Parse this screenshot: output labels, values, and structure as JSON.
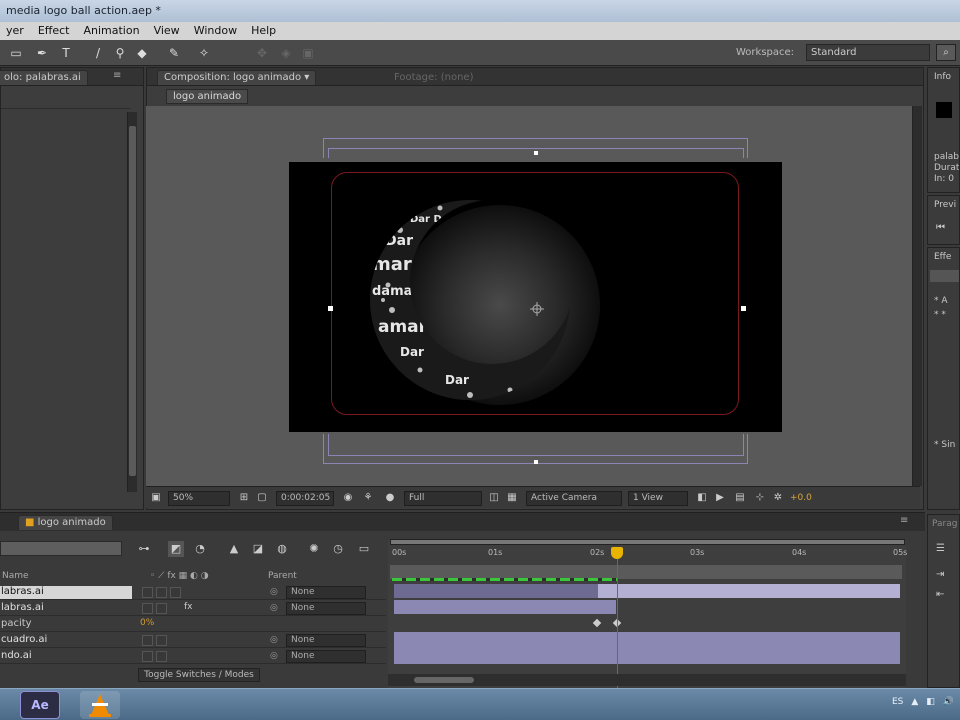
{
  "window": {
    "title": "media logo ball action.aep *"
  },
  "menu": {
    "items": [
      "yer",
      "Effect",
      "Animation",
      "View",
      "Window",
      "Help"
    ]
  },
  "toolbar": {
    "workspace_label": "Workspace:",
    "workspace_value": "Standard",
    "search_icon": "search-icon"
  },
  "left_panel": {
    "tab_label": "olo: palabras.ai"
  },
  "composition": {
    "tab_label": "Composition: logo animado",
    "footage_tab": "Footage: (none)",
    "layer_chip": "logo animado",
    "art_words": [
      "Dar Dent",
      "Dar",
      "mar",
      "dama",
      "amar",
      "Dar",
      "Dar"
    ],
    "controls": {
      "zoom": "50%",
      "timecode": "0:00:02:05",
      "resolution": "Full",
      "camera": "Active Camera",
      "views": "1 View",
      "exposure": "+0.0"
    }
  },
  "timeline": {
    "tab_label": "logo animado",
    "columns": {
      "name": "Name",
      "parent": "Parent"
    },
    "ruler": [
      "00s",
      "01s",
      "02s",
      "03s",
      "04s",
      "05s"
    ],
    "layers": [
      {
        "name": "labras.ai",
        "parent": "None",
        "selected": true
      },
      {
        "name": "labras.ai",
        "parent": "None",
        "selected": false
      },
      {
        "name": "pacity",
        "value": "0%",
        "is_property": true
      },
      {
        "name": "cuadro.ai",
        "parent": "None",
        "selected": false
      },
      {
        "name": "ndo.ai",
        "parent": "None",
        "selected": false
      }
    ],
    "toggle_label": "Toggle Switches / Modes"
  },
  "right_panels": {
    "info_tab": "Info",
    "info_lines": [
      "palab",
      "Durat",
      "In: 0"
    ],
    "preview_tab": "Previ",
    "effects_tab": "Effe",
    "effects_items": [
      "* A",
      "* *",
      "* Sin"
    ],
    "bottom_tab": "Parag"
  },
  "taskbar": {
    "apps": [
      "Ae",
      "VLC"
    ],
    "tray": [
      "ES",
      "▲",
      "◧",
      "🔊"
    ]
  },
  "colors": {
    "accent_cti": "#e8b400",
    "cti_line": "#e03050",
    "safe_frame": "#7a1820",
    "track": "#8b88b4"
  }
}
